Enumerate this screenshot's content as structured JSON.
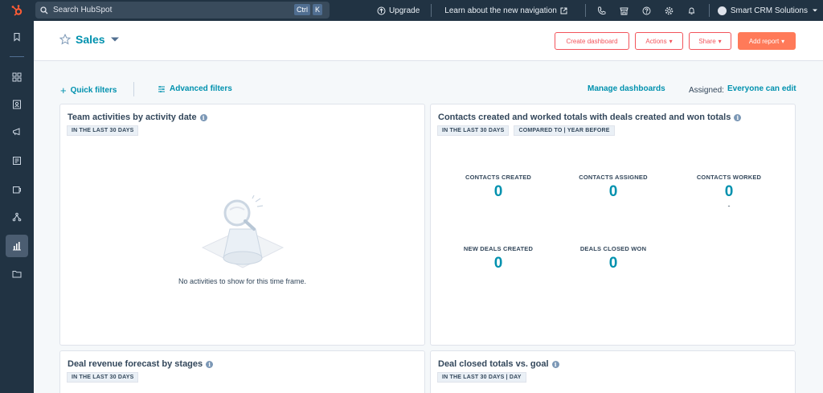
{
  "topbar": {
    "search_placeholder": "Search HubSpot",
    "kbd_ctrl": "Ctrl",
    "kbd_k": "K",
    "upgrade_label": "Upgrade",
    "learn_label": "Learn about the new navigation",
    "account_name": "Smart CRM Solutions"
  },
  "header": {
    "title": "Sales",
    "create_dashboard": "Create dashboard",
    "actions": "Actions",
    "share": "Share",
    "add_report": "Add report"
  },
  "filters": {
    "quick": "Quick filters",
    "advanced": "Advanced filters",
    "manage": "Manage dashboards",
    "assigned_label": "Assigned:",
    "assigned_value": "Everyone can edit"
  },
  "cards": {
    "team": {
      "title": "Team activities by activity date",
      "tag": "IN THE LAST 30 DAYS",
      "empty": "No activities to show for this time frame."
    },
    "contacts": {
      "title": "Contacts created and worked totals with deals created and won totals",
      "tag1": "IN THE LAST 30 DAYS",
      "tag2": "COMPARED TO | YEAR BEFORE",
      "metrics": [
        {
          "label": "CONTACTS CREATED",
          "value": "0"
        },
        {
          "label": "CONTACTS ASSIGNED",
          "value": "0"
        },
        {
          "label": "CONTACTS WORKED",
          "value": "0",
          "sub": "-"
        },
        {
          "label": "NEW DEALS CREATED",
          "value": "0"
        },
        {
          "label": "DEALS CLOSED WON",
          "value": "0"
        }
      ]
    },
    "forecast": {
      "title": "Deal revenue forecast by stages",
      "tag": "IN THE LAST 30 DAYS"
    },
    "closed": {
      "title": "Deal closed totals vs. goal",
      "tag": "IN THE LAST 30 DAYS | DAY"
    }
  },
  "colors": {
    "nav_bg": "#213343",
    "accent": "#0091ae",
    "primary_button": "#ff7a59",
    "logo": "#ff5c35"
  }
}
